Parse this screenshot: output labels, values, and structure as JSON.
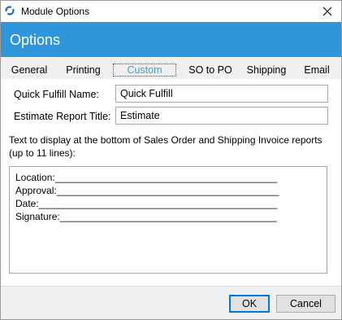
{
  "window": {
    "title": "Module Options",
    "close_glyph": "✕"
  },
  "banner": {
    "title": "Options"
  },
  "tabs": [
    {
      "label": "General"
    },
    {
      "label": "Printing"
    },
    {
      "label": "Custom",
      "active": true
    },
    {
      "label": "SO to PO"
    },
    {
      "label": "Shipping"
    },
    {
      "label": "Email"
    }
  ],
  "fields": {
    "quick_fulfill": {
      "label": "Quick Fulfill Name:",
      "value": "Quick Fulfill"
    },
    "estimate_title": {
      "label": "Estimate Report Title:",
      "value": "Estimate"
    }
  },
  "footer_text": {
    "description_line1": "Text to display at the bottom of Sales Order  and Shipping Invoice reports",
    "description_line2": "(up to 11 lines):",
    "lines": [
      "Location:_________________________________________",
      "Approval:_________________________________________",
      "Date:____________________________________________",
      "Signature:________________________________________"
    ]
  },
  "buttons": {
    "ok": "OK",
    "cancel": "Cancel"
  },
  "colors": {
    "accent": "#2f96dc",
    "active_tab": "#3aa0dc"
  }
}
